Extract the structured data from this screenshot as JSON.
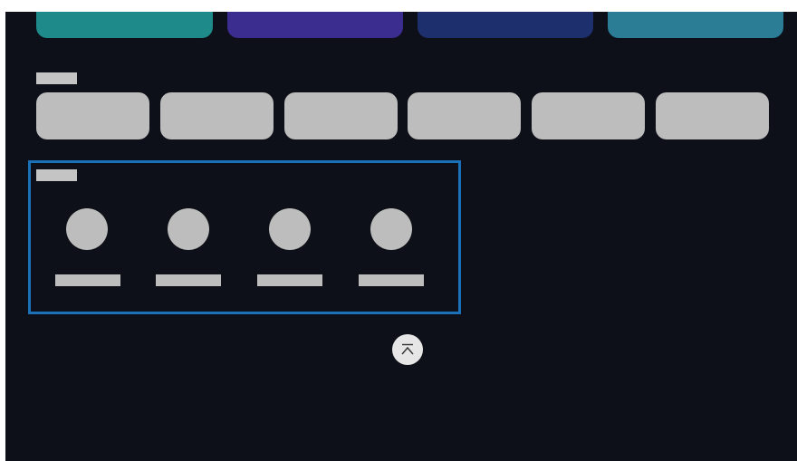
{
  "colors": {
    "background": "#0d1018",
    "placeholder": "#bdbdbd",
    "focus_ring": "#1a71b8",
    "top_cards": [
      "#1f8a8a",
      "#3b2c8f",
      "#1e2f6e",
      "#2a7d95"
    ]
  },
  "top_row": {
    "cards": [
      {
        "icon": "teal-card"
      },
      {
        "icon": "purple-card"
      },
      {
        "icon": "navy-card"
      },
      {
        "icon": "blue-teal-card"
      }
    ]
  },
  "chips_section": {
    "label": "",
    "chips": [
      "",
      "",
      "",
      "",
      "",
      ""
    ]
  },
  "people_section": {
    "label": "",
    "focused": true,
    "people": [
      {
        "name": ""
      },
      {
        "name": ""
      },
      {
        "name": ""
      },
      {
        "name": ""
      }
    ]
  },
  "scroll_to_top": {
    "icon": "chevron-up-icon"
  }
}
